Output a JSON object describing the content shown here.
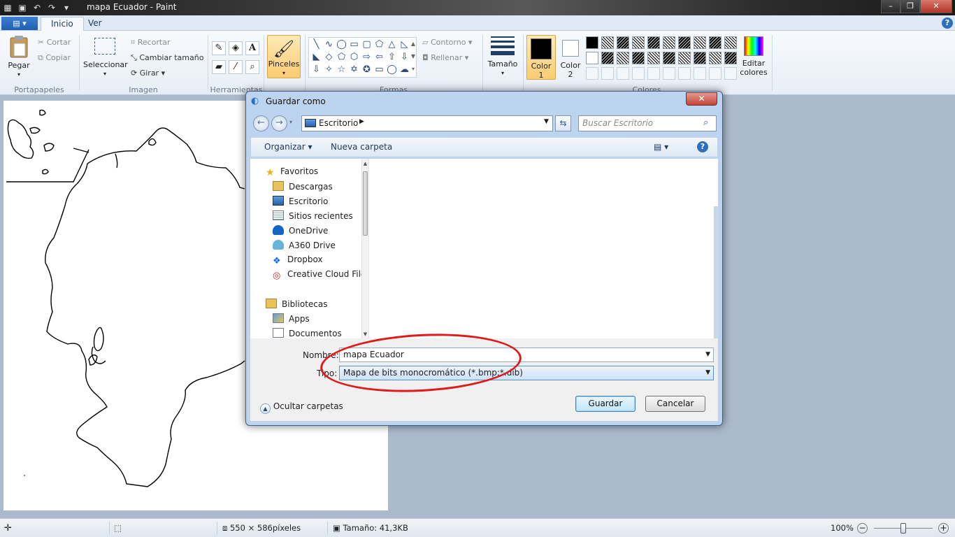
{
  "window": {
    "title": "mapa Ecuador - Paint"
  },
  "tabs": [
    "Inicio",
    "Ver"
  ],
  "ribbon": {
    "clipboard": {
      "paste": "Pegar",
      "cut": "Cortar",
      "copy": "Copiar",
      "group": "Portapapeles"
    },
    "image": {
      "select": "Seleccionar",
      "crop": "Recortar",
      "resize": "Cambiar tamaño",
      "rotate": "Girar",
      "group": "Imagen"
    },
    "tools": {
      "group": "Herramientas"
    },
    "brushes": {
      "label": "Pinceles"
    },
    "shapes": {
      "outline": "Contorno",
      "fill": "Rellenar",
      "group": "Formas"
    },
    "size": {
      "label": "Tamaño"
    },
    "colors": {
      "color1": "Color",
      "color1_num": "1",
      "color2": "Color",
      "color2_num": "2",
      "edit": "Editar",
      "edit2": "colores",
      "group": "Colores"
    }
  },
  "dialog": {
    "title": "Guardar como",
    "address": "Escritorio",
    "search_placeholder": "Buscar Escritorio",
    "organize": "Organizar",
    "new_folder": "Nueva carpeta",
    "nav": {
      "favorites": "Favoritos",
      "items": [
        "Descargas",
        "Escritorio",
        "Sitios recientes",
        "OneDrive",
        "A360 Drive",
        "Dropbox",
        "Creative Cloud Files"
      ],
      "libraries": "Bibliotecas",
      "lib_items": [
        "Apps",
        "Documentos"
      ]
    },
    "name_label": "Nombre:",
    "name_value": "mapa Ecuador",
    "type_label": "Tipo:",
    "type_value": "Mapa de bits monocromático (*.bmp;*.dib)",
    "hide_folders": "Ocultar carpetas",
    "save": "Guardar",
    "cancel": "Cancelar"
  },
  "status": {
    "dimensions": "550 × 586píxeles",
    "size": "Tamaño: 41,3KB",
    "zoom": "100%"
  },
  "colors": {
    "accent": "#2f6fc0",
    "highlight_ring": "#e01a1a",
    "brush_active": "#fcd58e"
  }
}
